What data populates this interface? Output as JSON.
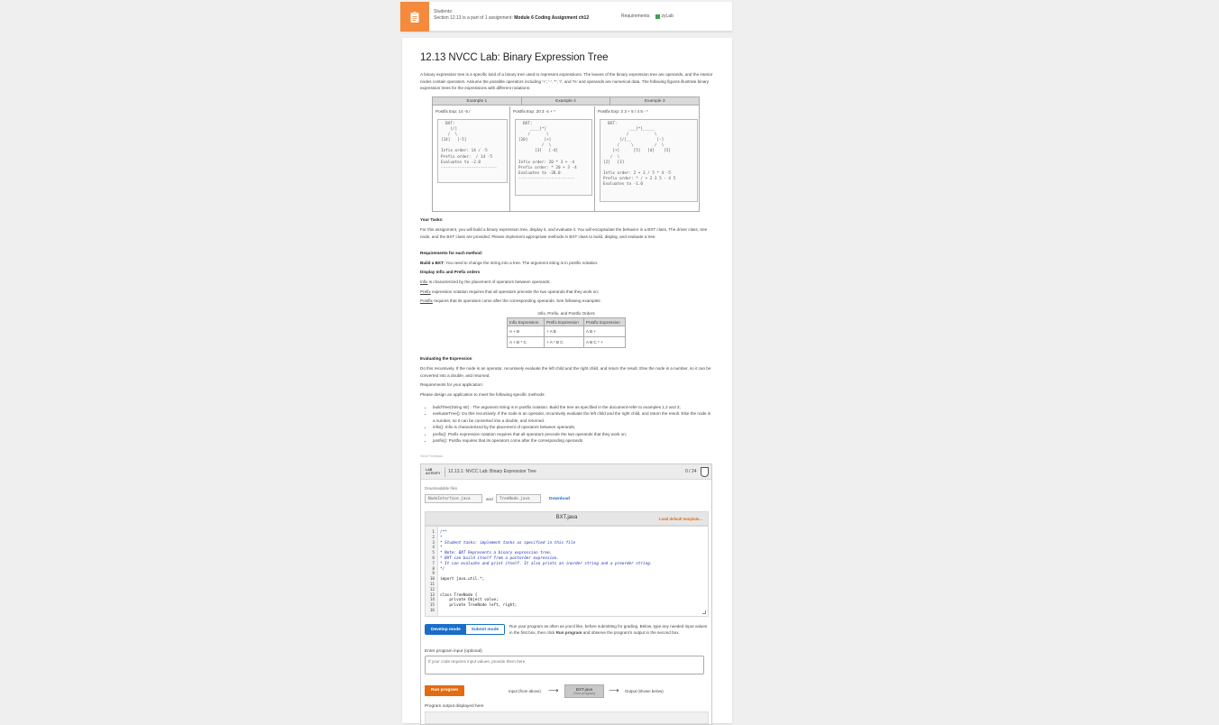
{
  "banner": {
    "line1": "Students:",
    "line2_prefix": "Section 12.13 is a part of 1 assignment: ",
    "line2_assignment": "Module 6 Coding Assignment ch12",
    "requirements_label": "Requirements:",
    "requirements_value": "zyLab"
  },
  "page": {
    "title": "12.13 NVCC Lab: Binary Expression Tree",
    "intro": "A binary expression tree is a specific kind of a binary tree used to represent expressions. The leaves of the binary expression tree are operands, and the interior nodes contain operators. Assume the possible operators including '+', '-', '*', '/', and '%' and operands are numerical data. The following figures illustrate binary expression trees for the expressions with different notations:"
  },
  "examples": {
    "headers": [
      "Example 1",
      "Example 2",
      "Example 3"
    ],
    "captions": [
      "Postfix Exp: 14 -5 /",
      "Postfix Exp: 20 3 -4 + *",
      "Postfix Exp: 2 3 + 5 / 4 5 - *"
    ],
    "trees": [
      "  BXT:\n    [/]\n   /  \\\n[14]   [-5]\n\nInfix order: 14 / -5\nPrefix order:  / 14 -5\nEvaluates to -2.8\n------------------------",
      "  BXT:\n     ____[*]\n    /       \\\n[20]       [+]\n          /  \\\n       [3]   [-4]\n\nInfix order: 20 * 3 + -4\nPrefix order: * 20 + 3 -4\nEvaluates to -20.0\n------------------------",
      "  BXT:\n           ___[*]_____\n          /           \\\n       [/]__           [-]\n      /     \\         /  \\\n    [+]      [5]   [4]    [5]\n   /  \\\n[2]   [3]\n\nInfix order: 2 + 3 / 5 * 4 -5\nPrefix order: * / + 2 3 5 - 4 5\nEvaluates to -1.0"
    ]
  },
  "tasks": {
    "heading": "Your Tasks:",
    "body": "For this assignment, you will build a binary expression tree, display it, and evaluate it. You will encapsulate the behavior in a BXT class. The driver class, tree node, and the BXT class are provided. Please implement appropriate methods in BXT class to build, display, and evaluate a tree.",
    "req_heading": "Requirements for each method:",
    "build_label": "Build a BXT",
    "build_text": ": You need to change the string into a tree. The argument string is in postfix notation.",
    "display_heading": "Display Infix and Prefix orders",
    "infix_word": "Infix",
    "infix_text": " is characterized by the placement of operators between operands;",
    "prefix_word": "Prefix",
    "prefix_text": " expression notation requires that all operators precede the two operands that they work on;",
    "postfix_word": "Postfix",
    "postfix_text": " requires that its operators come after the corresponding operands. See following examples:"
  },
  "orders_table": {
    "title": "Infix, Prefix, and Postfix Orders",
    "headers": [
      "Infix Expression",
      "Prefix Expression",
      "Postfix Expression"
    ],
    "rows": [
      [
        "A + B",
        "+ A B",
        "A B +"
      ],
      [
        "A + B * C",
        "+ A * B C",
        "A B C * +"
      ]
    ]
  },
  "evaluating": {
    "heading": "Evaluating the Expression",
    "body": "Do this recursively. If the node is an operator, recursively evaluate the left child and the right child, and return the result. Else the node is a number, so it can be converted into a double, and returned.",
    "req_app": "Requirements for your application:",
    "design": "Please design an application to meet the following specific methods:",
    "methods": [
      "buildTree(String str) : The argument string is in postfix notation. Build the tree as specified in the document-refer to examples 1,2 and 3;",
      "eveluateTree(): Do this recursively. If the node is an operator, recursively evaluate the left child and the right child, and return the result. Else the node is a number, so it can be converted into a double, and returned.",
      "infix(): Infix is characterized by the placement of operators between operands;",
      "prefix(): Prefix expression notation requires that all operators precede the two operands that they work on;",
      "posfix(): Postfix requires that its operators come after the corresponding operands"
    ],
    "feedback": "Send Feedback"
  },
  "lab": {
    "tag_line1": "LAB",
    "tag_line2": "ACTIVITY",
    "title": "12.13.1: NVCC Lab: Binary Expression Tree",
    "score": "0 / 24",
    "downloadable_label": "Downloadable files",
    "file1": "NodeInterface.java",
    "and": "and",
    "file2": "TreeNode.java",
    "download": "Download",
    "editor_file": "BXT.java",
    "load_default": "Load default template...",
    "code_lines": [
      {
        "n": "1",
        "t": "/**",
        "c": "cm"
      },
      {
        "n": "2",
        "t": "*",
        "c": "cm"
      },
      {
        "n": "3",
        "t": "* Student tasks: implement tasks as specified in this file",
        "c": "cm"
      },
      {
        "n": "4",
        "t": "*",
        "c": "cm"
      },
      {
        "n": "5",
        "t": "* Note: BXT Represents a binary expression tree.",
        "c": "cm"
      },
      {
        "n": "6",
        "t": "* BXT can build itself from a postorder expression.",
        "c": "cm"
      },
      {
        "n": "7",
        "t": "* It can evaluate and print itself. It also prints an inorder string and a preorder string.",
        "c": "cm"
      },
      {
        "n": "8",
        "t": "*/",
        "c": "cm"
      },
      {
        "n": "9",
        "t": "",
        "c": "plain"
      },
      {
        "n": "10",
        "t": "import java.util.*;",
        "c": "plain"
      },
      {
        "n": "11",
        "t": "",
        "c": "plain"
      },
      {
        "n": "12",
        "t": "",
        "c": "plain"
      },
      {
        "n": "13",
        "t": "class TreeNode {",
        "c": "plain"
      },
      {
        "n": "14",
        "t": "    private Object value;",
        "c": "plain"
      },
      {
        "n": "15",
        "t": "    private TreeNode left, right;",
        "c": "plain"
      },
      {
        "n": "16",
        "t": "",
        "c": "plain"
      }
    ],
    "develop_mode": "Develop mode",
    "submit_mode": "Submit mode",
    "mode_help_a": "Run your program as often as you'd like, before submitting for grading. Below, type any needed input values in the first box, then click ",
    "mode_help_b": "Run program",
    "mode_help_c": " and observe the program's output in the second box.",
    "input_label": "Enter program input (optional)",
    "input_placeholder": "If your code requires input values, provide them here.",
    "run_program": "Run program",
    "flow_input": "Input (from above)",
    "flow_box_title": "BXT.java",
    "flow_box_sub": "(Your program)",
    "flow_output": "Output (shown below)",
    "output_label": "Program output displayed here"
  }
}
